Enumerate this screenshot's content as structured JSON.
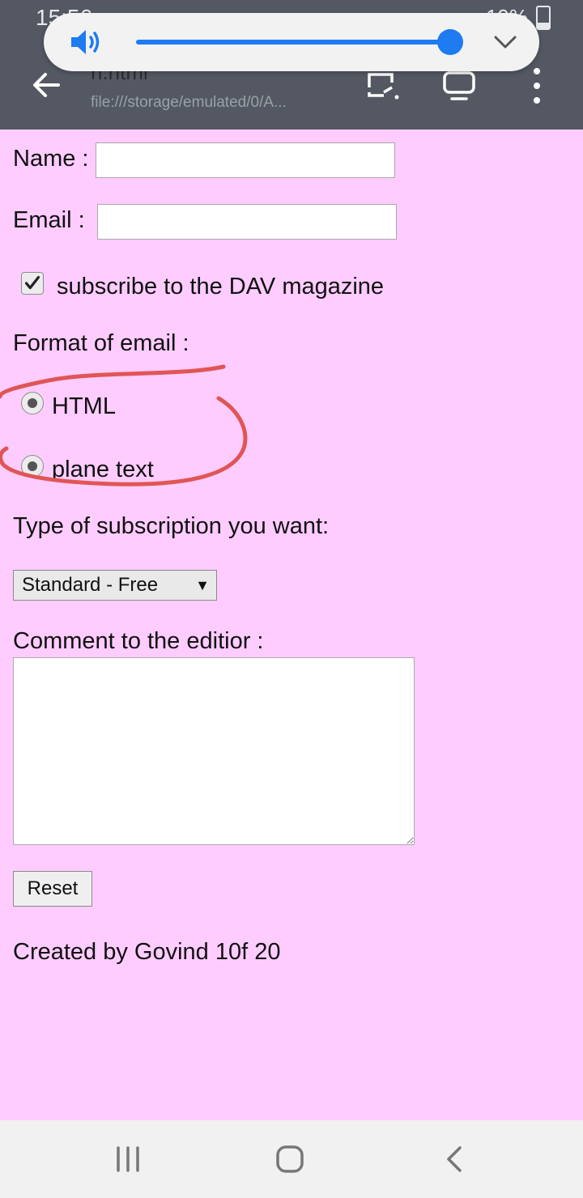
{
  "status": {
    "time": "15:56",
    "battery": "19%"
  },
  "browser": {
    "title": "h.html",
    "url": "file:///storage/emulated/0/A..."
  },
  "volume": {
    "level": 0.99,
    "accent": "#1e7bf2"
  },
  "form": {
    "name_label": "Name :",
    "name_value": "",
    "email_label": "Email :",
    "email_value": "",
    "subscribe_label": "subscribe to the DAV magazine",
    "subscribe_checked": true,
    "format_label": "Format of email :",
    "format_options": [
      "HTML",
      "plane text"
    ],
    "subscription_label": "Type of subscription you want:",
    "subscription_selected": "Standard - Free",
    "comment_label": "Comment to the editior :",
    "comment_value": "",
    "reset_label": "Reset",
    "footer": "Created by Govind 10f 20"
  },
  "colors": {
    "page_bg": "#ffccff",
    "chrome": "#535862",
    "annotation": "#e05555"
  }
}
